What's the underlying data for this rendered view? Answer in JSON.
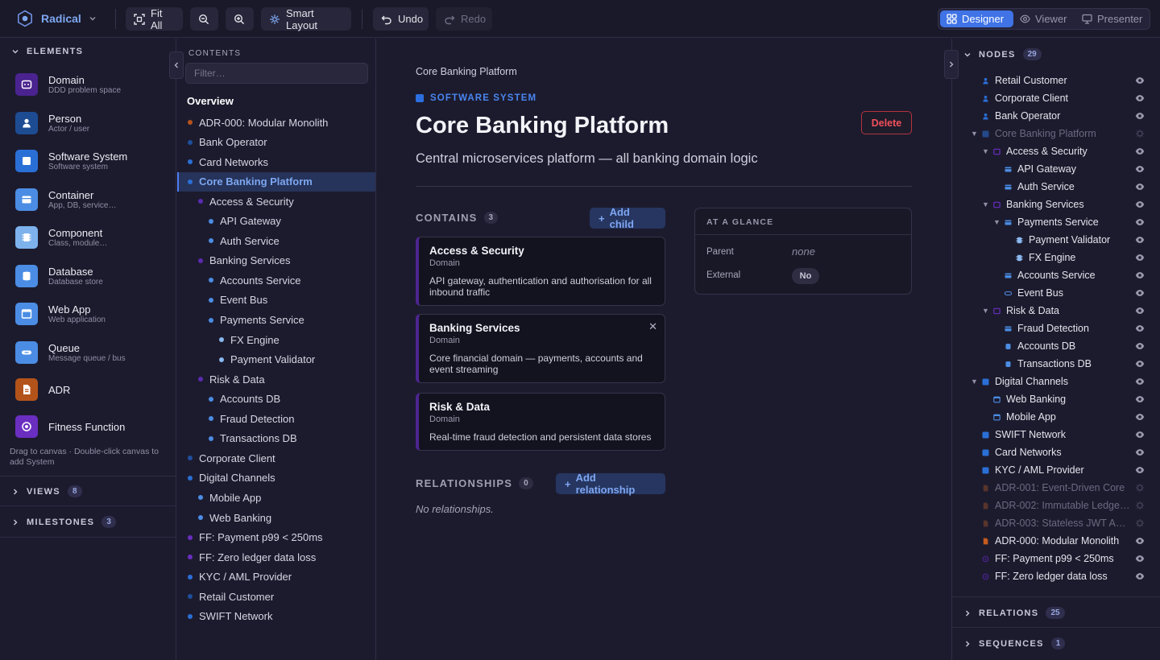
{
  "toolbar": {
    "brand": "Radical",
    "fit_all": "Fit All",
    "smart_layout": "Smart Layout",
    "undo": "Undo",
    "redo": "Redo",
    "modes": [
      {
        "label": "Designer",
        "active": true
      },
      {
        "label": "Viewer",
        "active": false
      },
      {
        "label": "Presenter",
        "active": false
      }
    ]
  },
  "elements_panel": {
    "title": "ELEMENTS",
    "items": [
      {
        "name": "Domain",
        "desc": "DDD problem space",
        "color": "#5a2bb0"
      },
      {
        "name": "Person",
        "desc": "Actor / user",
        "color": "#1f5bb5"
      },
      {
        "name": "Software System",
        "desc": "Software system",
        "color": "#2a6fd6"
      },
      {
        "name": "Container",
        "desc": "App, DB, service…",
        "color": "#4b8de4"
      },
      {
        "name": "Component",
        "desc": "Class, module…",
        "color": "#7db2ec"
      },
      {
        "name": "Database",
        "desc": "Database store",
        "color": "#4b8de4"
      },
      {
        "name": "Web App",
        "desc": "Web application",
        "color": "#4b8de4"
      },
      {
        "name": "Queue",
        "desc": "Message queue / bus",
        "color": "#4b8de4"
      },
      {
        "name": "ADR",
        "desc": "",
        "color": "#b3531a"
      },
      {
        "name": "Fitness Function",
        "desc": "",
        "color": "#6a2ec0"
      }
    ],
    "hint": "Drag to canvas · Double-click canvas to add System",
    "views": {
      "label": "VIEWS",
      "count": "8"
    },
    "milestones": {
      "label": "MILESTONES",
      "count": "3"
    }
  },
  "contents_panel": {
    "title": "CONTENTS",
    "filter_placeholder": "Filter…",
    "overview": "Overview",
    "items": [
      {
        "label": "ADR-000: Modular Monolith",
        "level": 0,
        "color": "#b8521c"
      },
      {
        "label": "Bank Operator",
        "level": 0,
        "color": "#1f4f9c"
      },
      {
        "label": "Card Networks",
        "level": 0,
        "color": "#2a6fd6"
      },
      {
        "label": "Core Banking Platform",
        "level": 0,
        "color": "#2a6fd6",
        "selected": true
      },
      {
        "label": "Access & Security",
        "level": 1,
        "color": "#5a2bb0"
      },
      {
        "label": "API Gateway",
        "level": 2,
        "color": "#4b8de4"
      },
      {
        "label": "Auth Service",
        "level": 2,
        "color": "#4b8de4"
      },
      {
        "label": "Banking Services",
        "level": 1,
        "color": "#5a2bb0"
      },
      {
        "label": "Accounts Service",
        "level": 2,
        "color": "#4b8de4"
      },
      {
        "label": "Event Bus",
        "level": 2,
        "color": "#4b8de4"
      },
      {
        "label": "Payments Service",
        "level": 2,
        "color": "#4b8de4"
      },
      {
        "label": "FX Engine",
        "level": 3,
        "color": "#8ab8ee"
      },
      {
        "label": "Payment Validator",
        "level": 3,
        "color": "#8ab8ee"
      },
      {
        "label": "Risk & Data",
        "level": 1,
        "color": "#5a2bb0"
      },
      {
        "label": "Accounts DB",
        "level": 2,
        "color": "#4b8de4"
      },
      {
        "label": "Fraud Detection",
        "level": 2,
        "color": "#4b8de4"
      },
      {
        "label": "Transactions DB",
        "level": 2,
        "color": "#4b8de4"
      },
      {
        "label": "Corporate Client",
        "level": 0,
        "color": "#1f4f9c"
      },
      {
        "label": "Digital Channels",
        "level": 0,
        "color": "#2a6fd6"
      },
      {
        "label": "Mobile App",
        "level": 1,
        "color": "#4b8de4"
      },
      {
        "label": "Web Banking",
        "level": 1,
        "color": "#4b8de4"
      },
      {
        "label": "FF: Payment p99 < 250ms",
        "level": 0,
        "color": "#6a2ec0"
      },
      {
        "label": "FF: Zero ledger data loss",
        "level": 0,
        "color": "#6a2ec0"
      },
      {
        "label": "KYC / AML Provider",
        "level": 0,
        "color": "#2a6fd6"
      },
      {
        "label": "Retail Customer",
        "level": 0,
        "color": "#1f4f9c"
      },
      {
        "label": "SWIFT Network",
        "level": 0,
        "color": "#2a6fd6"
      }
    ]
  },
  "main": {
    "breadcrumb": "Core Banking Platform",
    "type_label": "SOFTWARE SYSTEM",
    "title": "Core Banking Platform",
    "delete_label": "Delete",
    "description": "Central microservices platform — all banking domain logic",
    "contains": {
      "label": "CONTAINS",
      "count": "3",
      "add_label": "Add child"
    },
    "cards": [
      {
        "title": "Access & Security",
        "type": "Domain",
        "desc": "API gateway, authentication and authorisation for all inbound traffic"
      },
      {
        "title": "Banking Services",
        "type": "Domain",
        "desc": "Core financial domain — payments, accounts and event streaming"
      },
      {
        "title": "Risk & Data",
        "type": "Domain",
        "desc": "Real-time fraud detection and persistent data stores"
      }
    ],
    "relationships": {
      "label": "RELATIONSHIPS",
      "count": "0",
      "add_label": "Add relationship",
      "empty": "No relationships."
    },
    "glance": {
      "title": "AT A GLANCE",
      "parent_label": "Parent",
      "parent_value": "none",
      "external_label": "External",
      "external_value": "No"
    }
  },
  "nodes_panel": {
    "title": "NODES",
    "count": "29",
    "items": [
      {
        "label": "Retail Customer",
        "level": 0,
        "icon": "person",
        "color": "#2a6fd6"
      },
      {
        "label": "Corporate Client",
        "level": 0,
        "icon": "person",
        "color": "#2a6fd6"
      },
      {
        "label": "Bank Operator",
        "level": 0,
        "icon": "person",
        "color": "#2a6fd6"
      },
      {
        "label": "Core Banking Platform",
        "level": 0,
        "icon": "system",
        "color": "#2a6fd6",
        "caret": true,
        "muted": true
      },
      {
        "label": "Access & Security",
        "level": 1,
        "icon": "domain",
        "color": "#6a2ec0",
        "caret": true
      },
      {
        "label": "API Gateway",
        "level": 2,
        "icon": "container",
        "color": "#4b8de4"
      },
      {
        "label": "Auth Service",
        "level": 2,
        "icon": "container",
        "color": "#4b8de4"
      },
      {
        "label": "Banking Services",
        "level": 1,
        "icon": "domain",
        "color": "#6a2ec0",
        "caret": true
      },
      {
        "label": "Payments Service",
        "level": 2,
        "icon": "container",
        "color": "#4b8de4",
        "caret": true
      },
      {
        "label": "Payment Validator",
        "level": 3,
        "icon": "component",
        "color": "#8ab8ee"
      },
      {
        "label": "FX Engine",
        "level": 3,
        "icon": "component",
        "color": "#8ab8ee"
      },
      {
        "label": "Accounts Service",
        "level": 2,
        "icon": "container",
        "color": "#4b8de4"
      },
      {
        "label": "Event Bus",
        "level": 2,
        "icon": "queue",
        "color": "#4b8de4"
      },
      {
        "label": "Risk & Data",
        "level": 1,
        "icon": "domain",
        "color": "#6a2ec0",
        "caret": true
      },
      {
        "label": "Fraud Detection",
        "level": 2,
        "icon": "container",
        "color": "#4b8de4"
      },
      {
        "label": "Accounts DB",
        "level": 2,
        "icon": "database",
        "color": "#4b8de4"
      },
      {
        "label": "Transactions DB",
        "level": 2,
        "icon": "database",
        "color": "#4b8de4"
      },
      {
        "label": "Digital Channels",
        "level": 0,
        "icon": "system",
        "color": "#2a6fd6",
        "caret": true
      },
      {
        "label": "Web Banking",
        "level": 1,
        "icon": "webapp",
        "color": "#4b8de4"
      },
      {
        "label": "Mobile App",
        "level": 1,
        "icon": "webapp",
        "color": "#4b8de4"
      },
      {
        "label": "SWIFT Network",
        "level": 0,
        "icon": "system",
        "color": "#2a6fd6"
      },
      {
        "label": "Card Networks",
        "level": 0,
        "icon": "system",
        "color": "#2a6fd6"
      },
      {
        "label": "KYC / AML Provider",
        "level": 0,
        "icon": "system",
        "color": "#2a6fd6"
      },
      {
        "label": "ADR-001: Event-Driven Core",
        "level": 0,
        "icon": "adr",
        "color": "#8a4a2a",
        "muted": true
      },
      {
        "label": "ADR-002: Immutable Ledge…",
        "level": 0,
        "icon": "adr",
        "color": "#8a4a2a",
        "muted": true
      },
      {
        "label": "ADR-003: Stateless JWT A…",
        "level": 0,
        "icon": "adr",
        "color": "#8a4a2a",
        "muted": true
      },
      {
        "label": "ADR-000: Modular Monolith",
        "level": 0,
        "icon": "adr",
        "color": "#c35a1e"
      },
      {
        "label": "FF: Payment p99 < 250ms",
        "level": 0,
        "icon": "ff",
        "color": "#4a2390"
      },
      {
        "label": "FF: Zero ledger data loss",
        "level": 0,
        "icon": "ff",
        "color": "#4a2390"
      }
    ],
    "relations": {
      "label": "RELATIONS",
      "count": "25"
    },
    "sequences": {
      "label": "SEQUENCES",
      "count": "1"
    }
  }
}
